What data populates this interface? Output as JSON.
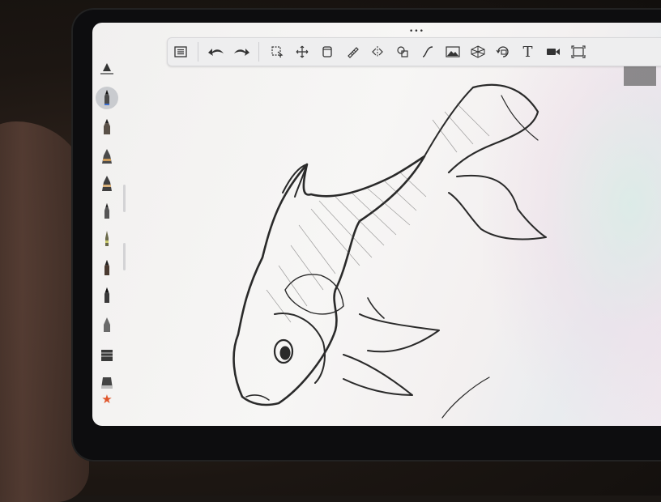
{
  "app": {
    "window_title": ""
  },
  "toolbar": {
    "drag_handle": "•••",
    "text_tool_glyph": "T",
    "tools": [
      "layers",
      "undo",
      "redo",
      "selection",
      "transform",
      "flipbook",
      "ruler",
      "symmetry",
      "shapes",
      "curve",
      "image",
      "perspective",
      "canvas",
      "text",
      "video",
      "fullscreen"
    ]
  },
  "sidebar": {
    "brushes": [
      "brush-1",
      "brush-2",
      "brush-3",
      "brush-4",
      "brush-5",
      "brush-6",
      "brush-7",
      "brush-8",
      "brush-9",
      "brush-10",
      "brush-11",
      "brush-12"
    ],
    "selected_index": 1,
    "favorites_glyph": "★"
  },
  "colors": {
    "accent_star": "#e0552b",
    "selected_tool_bg": "#c9cbcf",
    "toolbar_bg": "#eeeeef"
  }
}
